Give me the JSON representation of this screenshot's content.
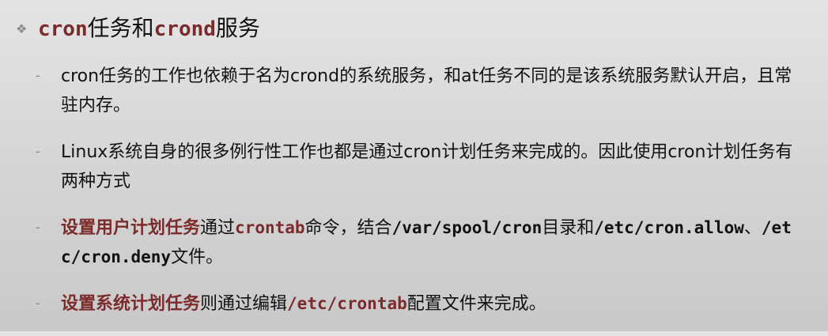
{
  "slide": {
    "title_bullet": "❖",
    "title": {
      "part1": "cron",
      "part2": "任务和",
      "part3": "crond",
      "part4": "服务"
    },
    "item_bullet": "-",
    "items": [
      {
        "text": "cron任务的工作也依赖于名为crond的系统服务，和at任务不同的是该系统服务默认开启，且常驻内存。"
      },
      {
        "text": "Linux系统自身的很多例行性工作也都是通过cron计划任务来完成的。因此使用cron计划任务有两种方式"
      },
      {
        "highlight": "设置用户计划任务",
        "t1": "通过",
        "code1": "crontab",
        "t2": "命令，结合",
        "code2": "/var/spool/cron",
        "t3": "目录和",
        "code3": "/etc/cron.allow",
        "t4": "、",
        "code4": "/etc/cron.deny",
        "t5": "文件。"
      },
      {
        "highlight": "设置系统计划任务",
        "t1": "则通过编辑",
        "code1": "/etc/crontab",
        "t2": "配置文件来完成。"
      }
    ]
  }
}
